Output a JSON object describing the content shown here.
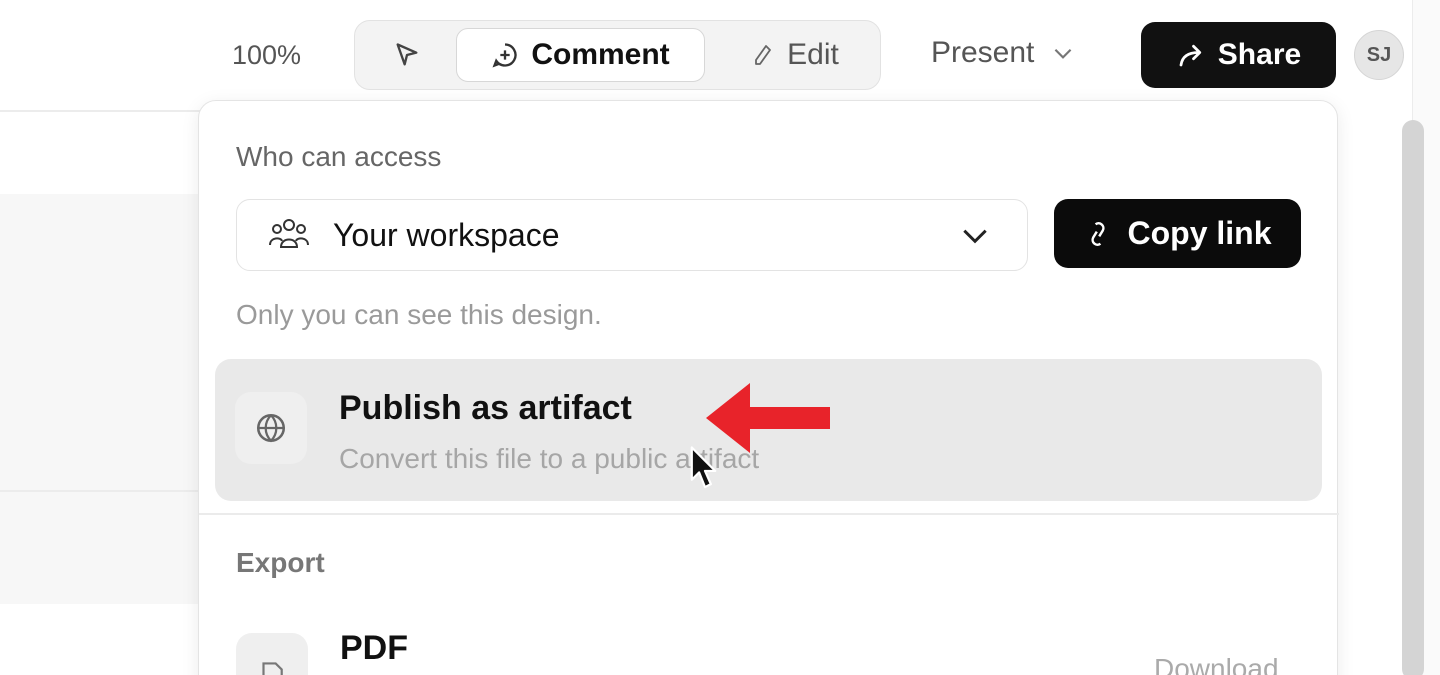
{
  "toolbar": {
    "zoom": "100%",
    "modes": {
      "comment_label": "Comment",
      "edit_label": "Edit"
    },
    "present_label": "Present",
    "share_label": "Share",
    "avatar_initials": "SJ"
  },
  "share_panel": {
    "access_title": "Who can access",
    "workspace_value": "Your workspace",
    "copy_link_label": "Copy link",
    "access_note": "Only you can see this design.",
    "publish": {
      "title": "Publish as artifact",
      "subtitle": "Convert this file to a public artifact"
    },
    "export_title": "Export",
    "export_items": [
      {
        "title": "PDF",
        "action": "Download"
      }
    ]
  },
  "colors": {
    "accent_dark": "#111111",
    "highlight_row": "#e9e9e9",
    "annotation_arrow": "#e8232a"
  },
  "icons": {
    "select": "cursor-pointer-icon",
    "comment": "comment-plus-icon",
    "edit": "pencil-icon",
    "present_caret": "chevron-down-icon",
    "share": "share-arrow-icon",
    "workspace": "people-group-icon",
    "copy_link": "link-icon",
    "publish": "globe-icon",
    "pdf": "file-icon"
  }
}
